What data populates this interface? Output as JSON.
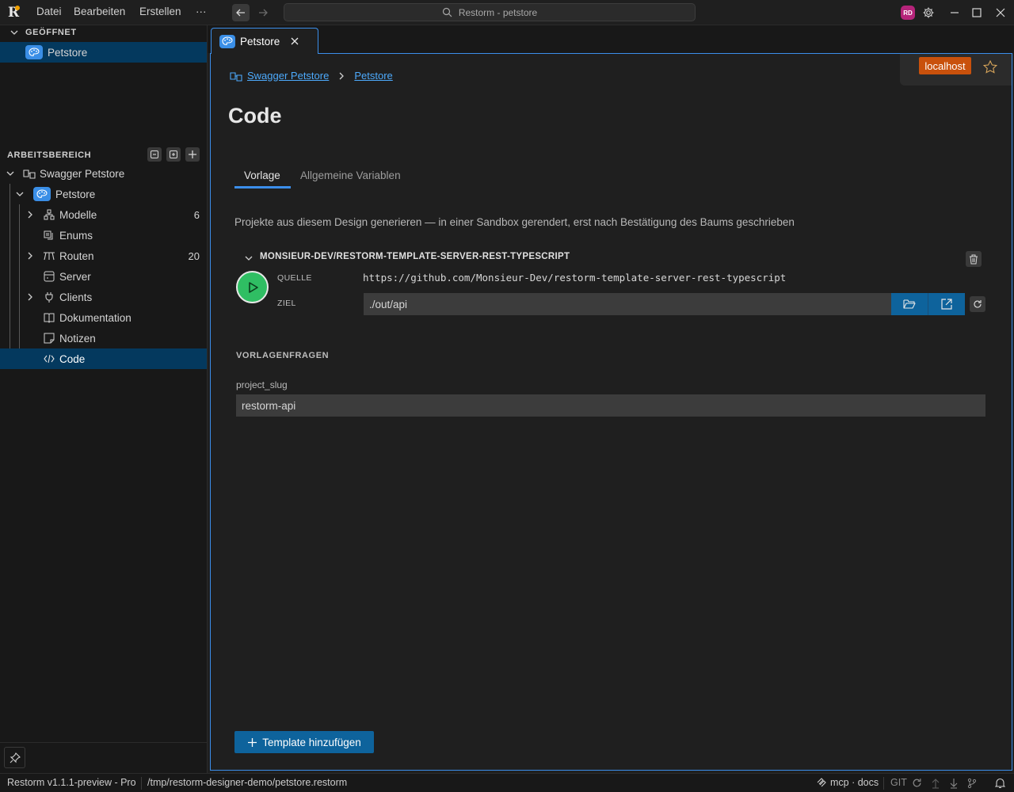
{
  "window": {
    "title": "Restorm - petstore",
    "menu": [
      "Datei",
      "Bearbeiten",
      "Erstellen",
      "···"
    ],
    "avatar_initials": "RD"
  },
  "sidebar": {
    "opened_title": "GEÖFFNET",
    "opened_item": "Petstore",
    "workspace_title": "ARBEITSBEREICH",
    "tree": {
      "root": "Swagger Petstore",
      "design": "Petstore",
      "items": [
        {
          "label": "Modelle",
          "count": "6",
          "icon": "models-icon",
          "expandable": true
        },
        {
          "label": "Enums",
          "count": "",
          "icon": "enum-icon",
          "expandable": false
        },
        {
          "label": "Routen",
          "count": "20",
          "icon": "routes-icon",
          "expandable": true
        },
        {
          "label": "Server",
          "count": "",
          "icon": "server-icon",
          "expandable": false
        },
        {
          "label": "Clients",
          "count": "",
          "icon": "plug-icon",
          "expandable": true
        },
        {
          "label": "Dokumentation",
          "count": "",
          "icon": "book-icon",
          "expandable": false
        },
        {
          "label": "Notizen",
          "count": "",
          "icon": "note-icon",
          "expandable": false
        },
        {
          "label": "Code",
          "count": "",
          "icon": "code-icon",
          "expandable": false,
          "selected": true
        }
      ]
    }
  },
  "editor": {
    "tab_label": "Petstore",
    "environment": "localhost",
    "breadcrumb": [
      "Swagger Petstore",
      "Petstore"
    ],
    "page_title": "Code",
    "subtabs": [
      "Vorlage",
      "Allgemeine Variablen"
    ],
    "active_subtab": "Vorlage",
    "description": "Projekte aus diesem Design generieren — in einer Sandbox gerendert, erst nach Bestätigung des Baums geschrieben",
    "template": {
      "name": "MONSIEUR-DEV/RESTORM-TEMPLATE-SERVER-REST-TYPESCRIPT",
      "source_label": "QUELLE",
      "source_value": "https://github.com/Monsieur-Dev/restorm-template-server-rest-typescript",
      "target_label": "ZIEL",
      "target_value": "./out/api"
    },
    "questions_title": "VORLAGENFRAGEN",
    "questions": [
      {
        "name": "project_slug",
        "value": "restorm-api"
      }
    ],
    "add_template_label": "Template hinzufügen"
  },
  "statusbar": {
    "version": "Restorm v1.1.1-preview - Pro",
    "path": "/tmp/restorm-designer-demo/petstore.restorm",
    "mcp": "mcp · docs",
    "git": "GIT"
  },
  "colors": {
    "accent": "#3b8eea",
    "primary_button": "#0e639c",
    "env_badge": "#c9510c",
    "run_button": "#2fbe63",
    "selection": "#04395e"
  }
}
